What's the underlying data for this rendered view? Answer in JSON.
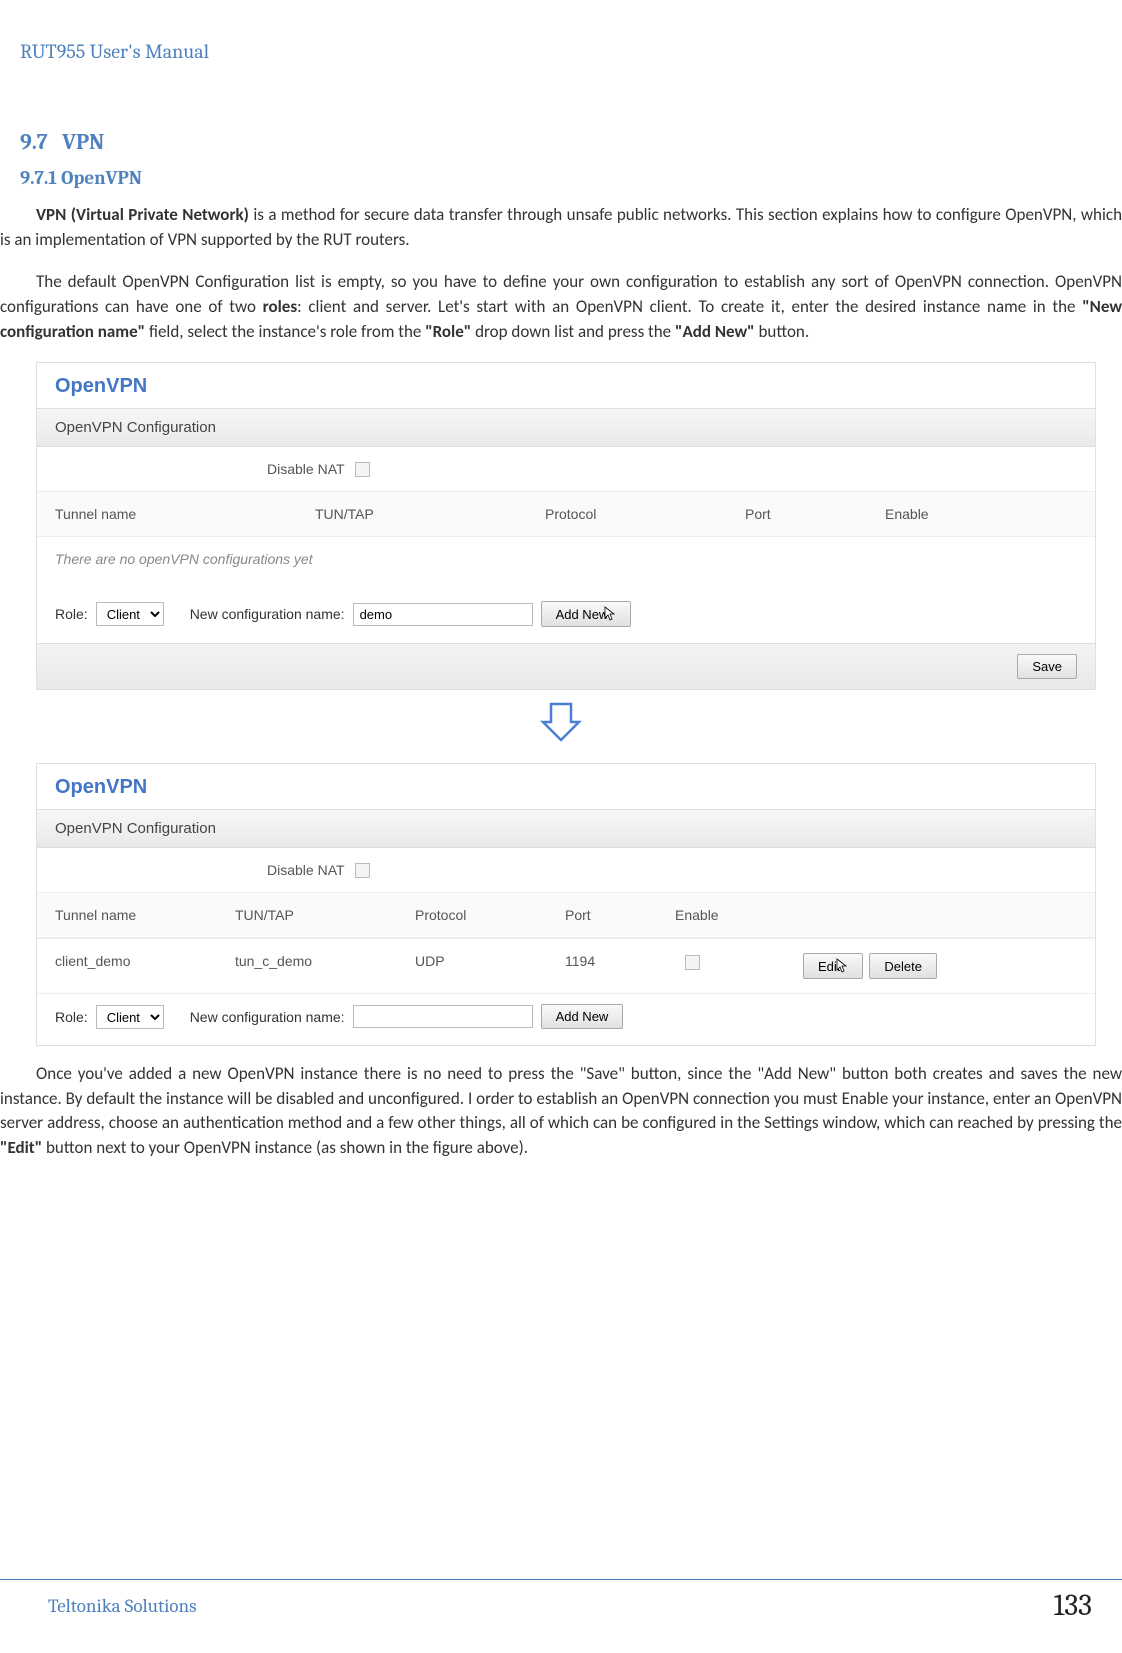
{
  "doc": {
    "header": "RUT955 User's Manual",
    "section_num": "9.7",
    "section_title": "VPN",
    "subsection_num": "9.7.1",
    "subsection_title": "OpenVPN",
    "para1_a": "VPN (Virtual Private Network)",
    "para1_b": " is a method for secure data transfer through unsafe public networks. This section explains how to configure OpenVPN, which is an implementation of VPN supported by the RUT routers.",
    "para2_a": "The default OpenVPN Configuration list is empty, so you have to define your own configuration to establish any sort of OpenVPN connection. OpenVPN configurations can have one of two ",
    "para2_b": "roles",
    "para2_c": ": client and server. Let's start with an OpenVPN client. To create it, enter the desired instance name in the ",
    "para2_d": "\"New configuration name\"",
    "para2_e": " field, select the instance's role from the ",
    "para2_f": "\"Role\"",
    "para2_g": " drop down list and press the ",
    "para2_h": "\"Add New\"",
    "para2_i": " button.",
    "para3_a": "Once you've added a new OpenVPN instance there is no need to press the \"Save\" button, since the \"Add New\" button both creates and saves the new instance. By default the instance will be disabled and unconfigured. I order to establish an OpenVPN connection you must Enable your instance, enter an OpenVPN server address, choose an authentication method and a few other things, all of which can be configured in the Settings window, which can reached by pressing the ",
    "para3_b": "\"Edit\"",
    "para3_c": " button next to your OpenVPN instance (as shown in the figure above).",
    "footer_brand": "Teltonika Solutions",
    "page_number": "133"
  },
  "ui": {
    "panel_title": "OpenVPN",
    "config_header": "OpenVPN Configuration",
    "disable_nat": "Disable NAT",
    "cols": {
      "tunnel": "Tunnel name",
      "tuntap": "TUN/TAP",
      "protocol": "Protocol",
      "port": "Port",
      "enable": "Enable"
    },
    "empty_msg": "There are no openVPN configurations yet",
    "role_label": "Role:",
    "role_option": "Client",
    "newcfg_label": "New configuration name:",
    "newcfg_value": "demo",
    "add_new": "Add New",
    "save": "Save",
    "row": {
      "tunnel": "client_demo",
      "tuntap": "tun_c_demo",
      "protocol": "UDP",
      "port": "1194"
    },
    "edit": "Edit",
    "delete": "Delete"
  }
}
